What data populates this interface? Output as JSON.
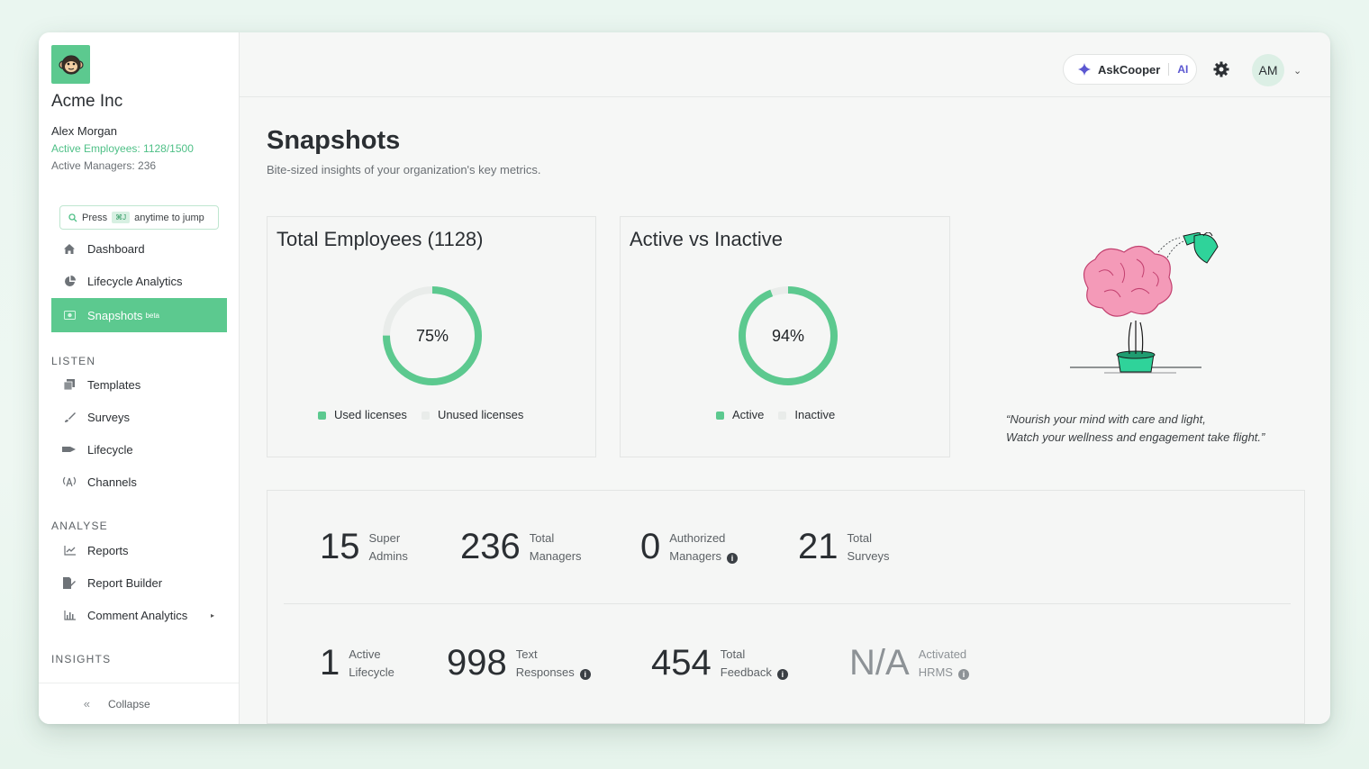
{
  "sidebar": {
    "company": "Acme Inc",
    "user_name": "Alex Morgan",
    "active_employees": "Active Employees: 1128/1500",
    "active_managers": "Active Managers: 236",
    "jump": {
      "press": "Press",
      "shortcut": "⌘J",
      "rest": "anytime to jump"
    },
    "items": [
      {
        "label": "Dashboard",
        "icon": "home-icon"
      },
      {
        "label": "Lifecycle Analytics",
        "icon": "pie-chart-icon"
      },
      {
        "label": "Snapshots",
        "badge": "beta",
        "icon": "snapshot-icon"
      }
    ],
    "listen_label": "LISTEN",
    "listen_items": [
      {
        "label": "Templates",
        "icon": "templates-icon"
      },
      {
        "label": "Surveys",
        "icon": "brush-icon"
      },
      {
        "label": "Lifecycle",
        "icon": "lifecycle-icon"
      },
      {
        "label": "Channels",
        "icon": "broadcast-icon"
      }
    ],
    "analyse_label": "ANALYSE",
    "analyse_items": [
      {
        "label": "Reports",
        "icon": "line-chart-icon"
      },
      {
        "label": "Report Builder",
        "icon": "report-builder-icon"
      },
      {
        "label": "Comment Analytics",
        "icon": "bar-chart-icon"
      }
    ],
    "insights_label": "INSIGHTS",
    "collapse_label": "Collapse"
  },
  "topbar": {
    "askcooper_label": "AskCooper",
    "ai_label": "AI",
    "avatar_initials": "AM"
  },
  "page": {
    "title": "Snapshots",
    "subtitle": "Bite-sized insights of your organization's key metrics."
  },
  "cards": {
    "employees": {
      "title": "Total Employees (1128)",
      "percent_label": "75%",
      "percent": 75,
      "legend": [
        "Used licenses",
        "Unused licenses"
      ]
    },
    "active": {
      "title": "Active vs Inactive",
      "percent_label": "94%",
      "percent": 94,
      "legend": [
        "Active",
        "Inactive"
      ]
    }
  },
  "quote": {
    "line1": "“Nourish your mind with care and light,",
    "line2": "Watch your wellness and engagement take flight.”"
  },
  "stats": [
    {
      "value": "15",
      "label1": "Super",
      "label2": "Admins",
      "info": false
    },
    {
      "value": "236",
      "label1": "Total",
      "label2": "Managers",
      "info": false
    },
    {
      "value": "0",
      "label1": "Authorized",
      "label2": "Managers",
      "info": true
    },
    {
      "value": "21",
      "label1": "Total",
      "label2": "Surveys",
      "info": false
    },
    {
      "value": "1",
      "label1": "Active",
      "label2": "Lifecycle",
      "info": false
    },
    {
      "value": "998",
      "label1": "Text",
      "label2": "Responses",
      "info": true
    },
    {
      "value": "454",
      "label1": "Total",
      "label2": "Feedback",
      "info": true
    },
    {
      "value": "N/A",
      "label1": "Activated",
      "label2": "HRMS",
      "info": true
    }
  ],
  "colors": {
    "accent": "#5cc98f",
    "ring_track": "#e9ecea",
    "ai_purple": "#5b57d1"
  }
}
